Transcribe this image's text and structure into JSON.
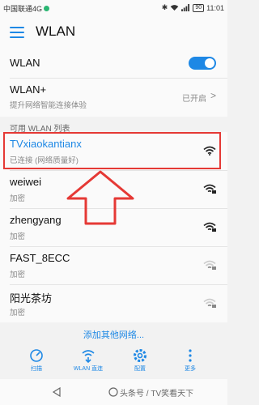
{
  "status_bar": {
    "carrier": "中国联通4G",
    "battery": "90",
    "time": "11:01"
  },
  "header": {
    "title": "WLAN"
  },
  "wlan_toggle": {
    "label": "WLAN"
  },
  "wlan_plus": {
    "label": "WLAN+",
    "description": "提升网络智能连接体验",
    "status": "已开启",
    "chevron": ">"
  },
  "section": {
    "title": "可用 WLAN 列表"
  },
  "networks": [
    {
      "name": "TVxiaokantianx",
      "status": "已连接 (网络质量好)",
      "icon": "wifi-full-icon"
    },
    {
      "name": "weiwei",
      "status": "加密",
      "icon": "wifi-locked-icon"
    },
    {
      "name": "zhengyang",
      "status": "加密",
      "icon": "wifi-locked-icon"
    },
    {
      "name": "FAST_8ECC",
      "status": "加密",
      "icon": "wifi-weak-locked-icon"
    },
    {
      "name": "阳光茶坊",
      "status": "加密",
      "icon": "wifi-weak-locked-icon"
    }
  ],
  "add_network": "添加其他网络...",
  "tabs": [
    {
      "label": "扫描",
      "icon": "scan-icon"
    },
    {
      "label": "WLAN 直连",
      "icon": "wifi-direct-icon"
    },
    {
      "label": "配置",
      "icon": "settings-icon"
    },
    {
      "label": "更多",
      "icon": "more-icon"
    }
  ],
  "watermark": "头条号 / TV笑看天下",
  "colors": {
    "accent": "#1e88e5",
    "highlight": "#e53935"
  }
}
